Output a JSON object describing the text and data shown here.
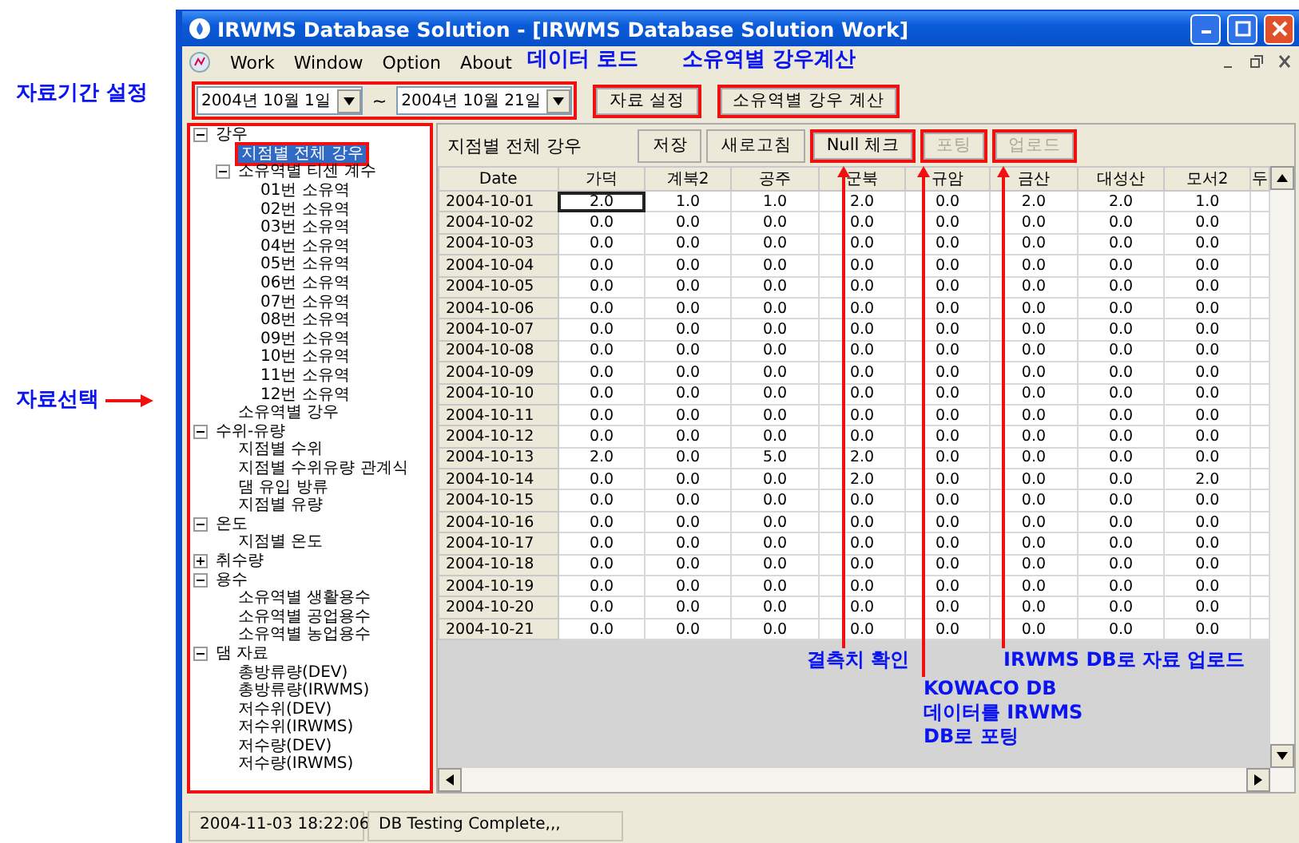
{
  "window": {
    "title": "IRWMS Database Solution - [IRWMS Database Solution Work]"
  },
  "menu": [
    "Work",
    "Window",
    "Option",
    "About"
  ],
  "toolbar": {
    "date_range": {
      "highlighted": true,
      "from": "2004년 10월  1일",
      "separator": "~",
      "to": "2004년 10월 21일"
    },
    "buttons": [
      {
        "label": "자료 설정",
        "highlighted": true
      },
      {
        "label": "소유역별 강우 계산",
        "highlighted": true
      }
    ]
  },
  "tree": {
    "highlighted": true,
    "items": [
      {
        "label": "강우",
        "selected": false,
        "expanded": true,
        "children": [
          {
            "label": "지점별 전체 강우",
            "selected": true,
            "highlighted": true
          },
          {
            "label": "소유역별 티센 계수",
            "selected": false,
            "expanded": true,
            "children": [
              {
                "label": "01번 소유역",
                "selected": false
              },
              {
                "label": "02번 소유역",
                "selected": false
              },
              {
                "label": "03번 소유역",
                "selected": false
              },
              {
                "label": "04번 소유역",
                "selected": false
              },
              {
                "label": "05번 소유역",
                "selected": false
              },
              {
                "label": "06번 소유역",
                "selected": false
              },
              {
                "label": "07번 소유역",
                "selected": false
              },
              {
                "label": "08번 소유역",
                "selected": false
              },
              {
                "label": "09번 소유역",
                "selected": false
              },
              {
                "label": "10번 소유역",
                "selected": false
              },
              {
                "label": "11번 소유역",
                "selected": false
              },
              {
                "label": "12번 소유역",
                "selected": false
              }
            ]
          },
          {
            "label": "소유역별 강우",
            "selected": false
          }
        ]
      },
      {
        "label": "수위-유량",
        "selected": false,
        "expanded": true,
        "children": [
          {
            "label": "지점별 수위",
            "selected": false
          },
          {
            "label": "지점별 수위유량 관계식",
            "selected": false
          },
          {
            "label": "댐 유입 방류",
            "selected": false
          },
          {
            "label": "지점별 유량",
            "selected": false
          }
        ]
      },
      {
        "label": "온도",
        "selected": false,
        "expanded": true,
        "children": [
          {
            "label": "지점별 온도",
            "selected": false
          }
        ]
      },
      {
        "label": "취수량",
        "selected": false,
        "expanded": false
      },
      {
        "label": "용수",
        "selected": false,
        "expanded": true,
        "children": [
          {
            "label": "소유역별 생활용수",
            "selected": false
          },
          {
            "label": "소유역별 공업용수",
            "selected": false
          },
          {
            "label": "소유역별 농업용수",
            "selected": false
          }
        ]
      },
      {
        "label": "댐 자료",
        "selected": false,
        "expanded": true,
        "children": [
          {
            "label": "총방류량(DEV)",
            "selected": false
          },
          {
            "label": "총방류량(IRWMS)",
            "selected": false
          },
          {
            "label": "저수위(DEV)",
            "selected": false
          },
          {
            "label": "저수위(IRWMS)",
            "selected": false
          },
          {
            "label": "저수량(DEV)",
            "selected": false
          },
          {
            "label": "저수량(IRWMS)",
            "selected": false
          }
        ]
      }
    ]
  },
  "panel": {
    "title": "지점별 전체 강우",
    "buttons": [
      {
        "label": "저장",
        "disabled": false,
        "highlighted": false
      },
      {
        "label": "새로고침",
        "disabled": false,
        "highlighted": false
      },
      {
        "label": "Null 체크",
        "disabled": false,
        "highlighted": true
      },
      {
        "label": "포팅",
        "disabled": true,
        "highlighted": true
      },
      {
        "label": "업로드",
        "disabled": true,
        "highlighted": true
      }
    ]
  },
  "table": {
    "columns": [
      "Date",
      "가덕",
      "계북2",
      "공주",
      "군북",
      "규암",
      "금산",
      "대성산",
      "모서2",
      "두"
    ],
    "rows": [
      {
        "cells": [
          "2004-10-01",
          "2.0",
          "1.0",
          "1.0",
          "2.0",
          "0.0",
          "2.0",
          "2.0",
          "1.0"
        ]
      },
      {
        "cells": [
          "2004-10-02",
          "0.0",
          "0.0",
          "0.0",
          "0.0",
          "0.0",
          "0.0",
          "0.0",
          "0.0"
        ]
      },
      {
        "cells": [
          "2004-10-03",
          "0.0",
          "0.0",
          "0.0",
          "0.0",
          "0.0",
          "0.0",
          "0.0",
          "0.0"
        ]
      },
      {
        "cells": [
          "2004-10-04",
          "0.0",
          "0.0",
          "0.0",
          "0.0",
          "0.0",
          "0.0",
          "0.0",
          "0.0"
        ]
      },
      {
        "cells": [
          "2004-10-05",
          "0.0",
          "0.0",
          "0.0",
          "0.0",
          "0.0",
          "0.0",
          "0.0",
          "0.0"
        ]
      },
      {
        "cells": [
          "2004-10-06",
          "0.0",
          "0.0",
          "0.0",
          "0.0",
          "0.0",
          "0.0",
          "0.0",
          "0.0"
        ]
      },
      {
        "cells": [
          "2004-10-07",
          "0.0",
          "0.0",
          "0.0",
          "0.0",
          "0.0",
          "0.0",
          "0.0",
          "0.0"
        ]
      },
      {
        "cells": [
          "2004-10-08",
          "0.0",
          "0.0",
          "0.0",
          "0.0",
          "0.0",
          "0.0",
          "0.0",
          "0.0"
        ]
      },
      {
        "cells": [
          "2004-10-09",
          "0.0",
          "0.0",
          "0.0",
          "0.0",
          "0.0",
          "0.0",
          "0.0",
          "0.0"
        ]
      },
      {
        "cells": [
          "2004-10-10",
          "0.0",
          "0.0",
          "0.0",
          "0.0",
          "0.0",
          "0.0",
          "0.0",
          "0.0"
        ]
      },
      {
        "cells": [
          "2004-10-11",
          "0.0",
          "0.0",
          "0.0",
          "0.0",
          "0.0",
          "0.0",
          "0.0",
          "0.0"
        ]
      },
      {
        "cells": [
          "2004-10-12",
          "0.0",
          "0.0",
          "0.0",
          "0.0",
          "0.0",
          "0.0",
          "0.0",
          "0.0"
        ]
      },
      {
        "cells": [
          "2004-10-13",
          "2.0",
          "0.0",
          "5.0",
          "2.0",
          "0.0",
          "0.0",
          "0.0",
          "0.0"
        ]
      },
      {
        "cells": [
          "2004-10-14",
          "0.0",
          "0.0",
          "0.0",
          "2.0",
          "0.0",
          "0.0",
          "0.0",
          "2.0"
        ]
      },
      {
        "cells": [
          "2004-10-15",
          "0.0",
          "0.0",
          "0.0",
          "0.0",
          "0.0",
          "0.0",
          "0.0",
          "0.0"
        ]
      },
      {
        "cells": [
          "2004-10-16",
          "0.0",
          "0.0",
          "0.0",
          "0.0",
          "0.0",
          "0.0",
          "0.0",
          "0.0"
        ]
      },
      {
        "cells": [
          "2004-10-17",
          "0.0",
          "0.0",
          "0.0",
          "0.0",
          "0.0",
          "0.0",
          "0.0",
          "0.0"
        ]
      },
      {
        "cells": [
          "2004-10-18",
          "0.0",
          "0.0",
          "0.0",
          "0.0",
          "0.0",
          "0.0",
          "0.0",
          "0.0"
        ]
      },
      {
        "cells": [
          "2004-10-19",
          "0.0",
          "0.0",
          "0.0",
          "0.0",
          "0.0",
          "0.0",
          "0.0",
          "0.0"
        ]
      },
      {
        "cells": [
          "2004-10-20",
          "0.0",
          "0.0",
          "0.0",
          "0.0",
          "0.0",
          "0.0",
          "0.0",
          "0.0"
        ]
      },
      {
        "cells": [
          "2004-10-21",
          "0.0",
          "0.0",
          "0.0",
          "0.0",
          "0.0",
          "0.0",
          "0.0",
          "0.0"
        ]
      }
    ]
  },
  "status_bar": [
    "2004-11-03 18:22:06",
    "DB Testing Complete,,,"
  ],
  "annotations": [
    {
      "kind": "label",
      "text": "자료기간 설정"
    },
    {
      "kind": "arrow-right",
      "text": "자료선택"
    },
    {
      "kind": "label",
      "text": "데이터 로드"
    },
    {
      "kind": "label",
      "text": "소유역별 강우계산"
    },
    {
      "kind": "arrow-up",
      "text": "결측치 확인"
    },
    {
      "kind": "arrow-up",
      "text": "KOWACO DB\n데이터를 IRWMS\nDB로 포팅"
    },
    {
      "kind": "arrow-up",
      "text": "IRWMS DB로 자료 업로드"
    }
  ]
}
